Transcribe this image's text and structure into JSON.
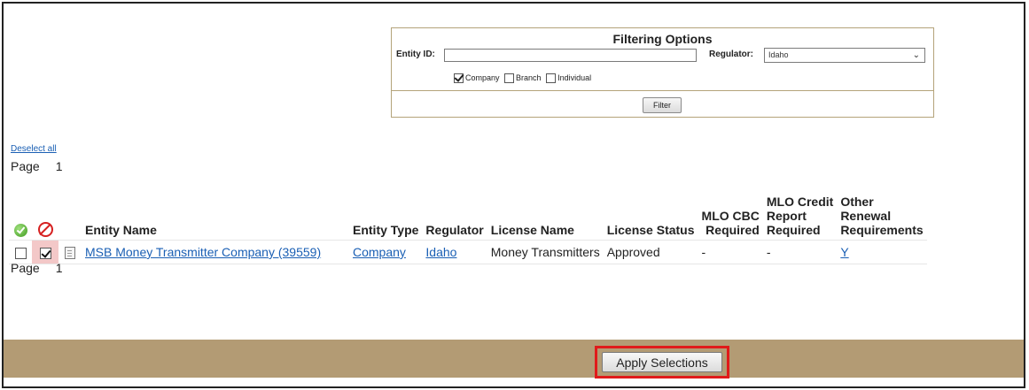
{
  "filter": {
    "title": "Filtering Options",
    "entity_id_label": "Entity ID:",
    "entity_id_value": "",
    "regulator_label": "Regulator:",
    "regulator_value": "Idaho",
    "checkboxes": [
      {
        "label": "Company",
        "checked": true
      },
      {
        "label": "Branch",
        "checked": false
      },
      {
        "label": "Individual",
        "checked": false
      }
    ],
    "filter_button": "Filter"
  },
  "deselect_all": "Deselect all",
  "page_label": "Page",
  "page_number": "1",
  "table": {
    "headers": {
      "entity_name": "Entity Name",
      "entity_type": "Entity Type",
      "regulator": "Regulator",
      "license_name": "License Name",
      "license_status": "License Status",
      "mlo_cbc_1": "MLO CBC",
      "mlo_cbc_2": "Required",
      "mlo_credit_1": "MLO Credit",
      "mlo_credit_2": "Report",
      "mlo_credit_3": "Required",
      "other_1": "Other",
      "other_2": "Renewal",
      "other_3": "Requirements"
    },
    "rows": [
      {
        "approve_checked": false,
        "reject_checked": true,
        "entity_name": "MSB Money Transmitter Company (39559)",
        "entity_type": "Company",
        "regulator": "Idaho",
        "license_name": "Money Transmitters",
        "license_status": "Approved",
        "mlo_cbc": "-",
        "mlo_credit": "-",
        "other_renewal": "Y"
      }
    ]
  },
  "apply_button": "Apply Selections",
  "colors": {
    "bottom_bar": "#b39b74",
    "highlight": "#e01a1a",
    "link": "#1a5fb4",
    "reject_cell": "#f3c8c8"
  },
  "icons": {
    "approve_all": "green-check-icon",
    "reject_all": "prohibited-icon",
    "row_detail": "document-icon"
  }
}
